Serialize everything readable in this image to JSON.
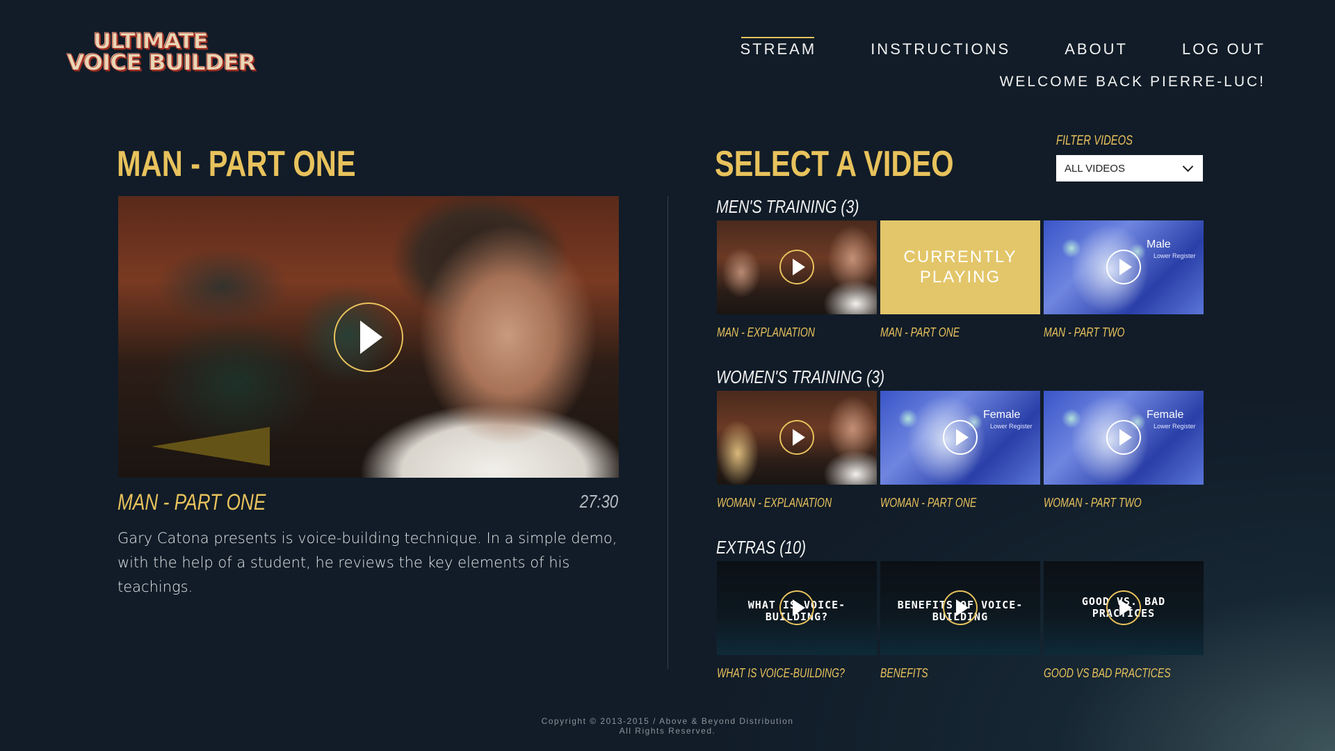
{
  "logo": {
    "line1": "ULTIMATE",
    "line2": "VOICE BUILDER"
  },
  "nav": {
    "items": [
      {
        "label": "STREAM",
        "active": true
      },
      {
        "label": "INSTRUCTIONS",
        "active": false
      },
      {
        "label": "ABOUT",
        "active": false
      },
      {
        "label": "LOG OUT",
        "active": false
      }
    ],
    "welcome": "WELCOME BACK PIERRE-LUC!"
  },
  "player": {
    "heading": "MAN - PART ONE",
    "video_title": "MAN - PART ONE",
    "duration": "27:30",
    "description": "Gary Catona presents is voice-building technique. In a simple demo, with the help of a student, he reviews the key elements of his teachings."
  },
  "browser": {
    "heading": "SELECT A VIDEO",
    "filter": {
      "label": "FILTER VIDEOS",
      "selected": "ALL VIDEOS"
    },
    "sections": [
      {
        "title": "MEN'S TRAINING (3)",
        "videos": [
          {
            "label": "MAN - EXPLANATION"
          },
          {
            "label": "MAN - PART ONE",
            "overlay": "CURRENTLY PLAYING"
          },
          {
            "label": "MAN - PART TWO",
            "thumb_title": "Male",
            "thumb_subtitle": "Lower Register"
          }
        ]
      },
      {
        "title": "WOMEN'S TRAINING (3)",
        "videos": [
          {
            "label": "WOMAN - EXPLANATION"
          },
          {
            "label": "WOMAN - PART ONE",
            "thumb_title": "Female",
            "thumb_subtitle": "Lower Register"
          },
          {
            "label": "WOMAN - PART TWO",
            "thumb_title": "Female",
            "thumb_subtitle": "Lower Register"
          }
        ]
      },
      {
        "title": "EXTRAS (10)",
        "videos": [
          {
            "label": "WHAT IS VOICE-BUILDING?",
            "thumb_text": "WHAT IS VOICE-BUILDING?"
          },
          {
            "label": "BENEFITS",
            "thumb_text": "BENEFITS OF VOICE-BUILDING"
          },
          {
            "label": "GOOD VS BAD PRACTICES",
            "thumb_text": "GOOD VS. BAD PRACTICES"
          }
        ]
      }
    ]
  },
  "footer": {
    "line1": "Copyright © 2013-2015 / Above & Beyond Distribution",
    "line2": "All Rights Reserved."
  },
  "colors": {
    "accent": "#e8c25c",
    "background": "#111c28"
  }
}
